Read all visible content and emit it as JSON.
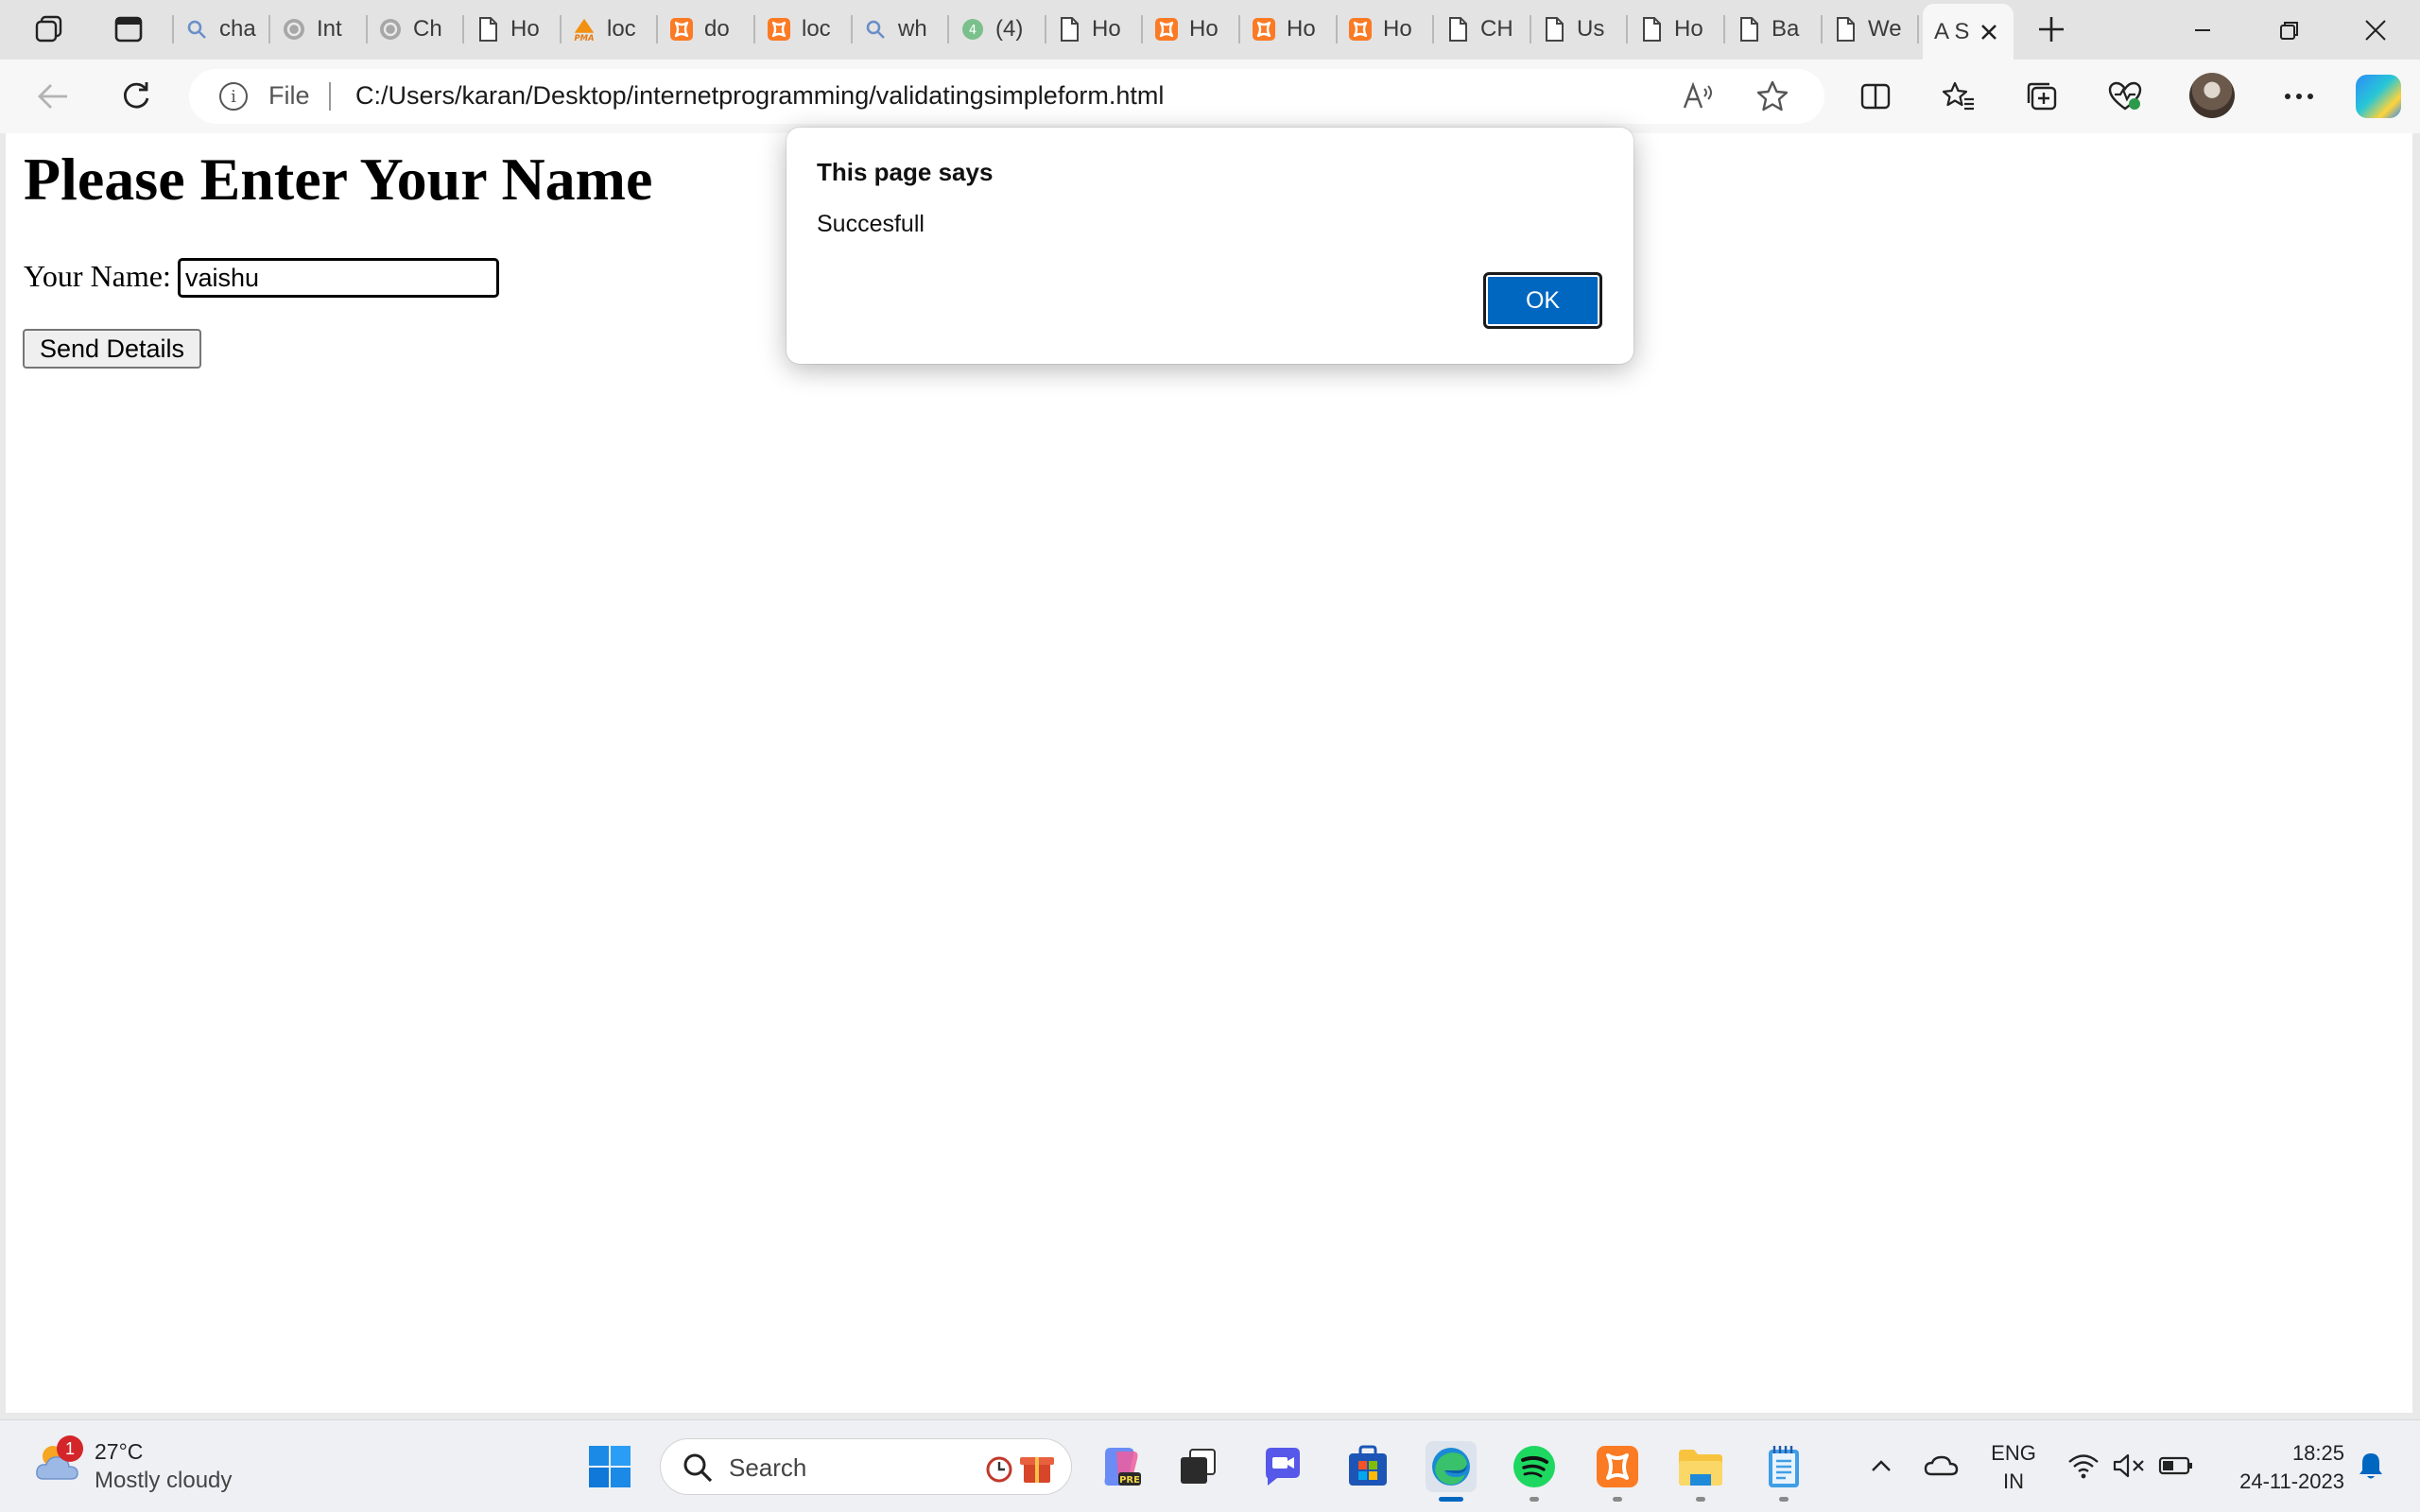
{
  "browser": {
    "tabs": [
      {
        "label": "cha",
        "icon": "search-icon"
      },
      {
        "label": "Int",
        "icon": "ai-icon"
      },
      {
        "label": "Ch",
        "icon": "ai-icon"
      },
      {
        "label": "Ho",
        "icon": "document-icon"
      },
      {
        "label": "loc",
        "icon": "phpmyadmin-icon",
        "icon_text": "PMA"
      },
      {
        "label": "do",
        "icon": "xampp-icon"
      },
      {
        "label": "loc",
        "icon": "xampp-icon"
      },
      {
        "label": "wh",
        "icon": "search-icon"
      },
      {
        "label": "(4)",
        "icon": "green-circle-icon",
        "icon_text": "4"
      },
      {
        "label": "Ho",
        "icon": "document-icon"
      },
      {
        "label": "Ho",
        "icon": "xampp-icon"
      },
      {
        "label": "Ho",
        "icon": "xampp-icon"
      },
      {
        "label": "Ho",
        "icon": "xampp-icon"
      },
      {
        "label": "CH",
        "icon": "document-icon"
      },
      {
        "label": "Us",
        "icon": "document-icon"
      },
      {
        "label": "Ho",
        "icon": "document-icon"
      },
      {
        "label": "Ba",
        "icon": "document-icon"
      },
      {
        "label": "We",
        "icon": "document-icon"
      }
    ],
    "active_tab": {
      "label": "A S",
      "icon": "close-icon"
    },
    "address": {
      "scheme_label": "File",
      "url": "C:/Users/karan/Desktop/internetprogramming/validatingsimpleform.html"
    }
  },
  "page": {
    "heading": "Please Enter Your Name",
    "name_label": "Your Name:",
    "name_value": "vaishu",
    "submit_label": "Send Details"
  },
  "dialog": {
    "title": "This page says",
    "message": "Succesfull",
    "ok_label": "OK",
    "ok_color": "#0067c0"
  },
  "taskbar": {
    "weather": {
      "badge": "1",
      "temperature": "27°C",
      "description": "Mostly cloudy"
    },
    "search_placeholder": "Search",
    "apps": [
      "copilot-pre-icon",
      "task-view-icon",
      "meet-icon",
      "store-icon",
      "edge-icon",
      "spotify-icon",
      "xampp-icon",
      "file-explorer-icon",
      "notepad-icon"
    ],
    "language": {
      "line1": "ENG",
      "line2": "IN"
    },
    "clock": {
      "time": "18:25",
      "date": "24-11-2023"
    }
  }
}
